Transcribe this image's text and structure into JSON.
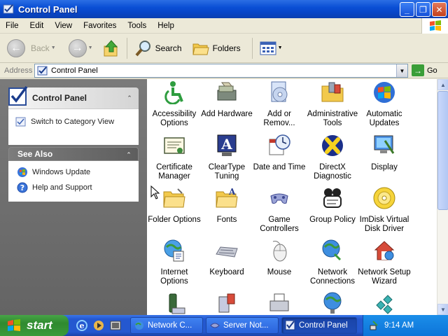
{
  "window": {
    "title": "Control Panel"
  },
  "menu": [
    "File",
    "Edit",
    "View",
    "Favorites",
    "Tools",
    "Help"
  ],
  "toolbar": {
    "back": "Back",
    "search": "Search",
    "folders": "Folders"
  },
  "address": {
    "label": "Address",
    "value": "Control Panel",
    "go": "Go"
  },
  "left": {
    "panel_title": "Control Panel",
    "switch_view": "Switch to Category View",
    "see_also_title": "See Also",
    "see_also": [
      "Windows Update",
      "Help and Support"
    ]
  },
  "items": [
    {
      "label": "Accessibility Options"
    },
    {
      "label": "Add Hardware"
    },
    {
      "label": "Add or Remov..."
    },
    {
      "label": "Administrative Tools"
    },
    {
      "label": "Automatic Updates"
    },
    {
      "label": "Certificate Manager"
    },
    {
      "label": "ClearType Tuning"
    },
    {
      "label": "Date and Time"
    },
    {
      "label": "DirectX Diagnostic"
    },
    {
      "label": "Display"
    },
    {
      "label": "Folder Options"
    },
    {
      "label": "Fonts"
    },
    {
      "label": "Game Controllers"
    },
    {
      "label": "Group Policy"
    },
    {
      "label": "ImDisk Virtual Disk Driver"
    },
    {
      "label": "Internet Options"
    },
    {
      "label": "Keyboard"
    },
    {
      "label": "Mouse"
    },
    {
      "label": "Network Connections"
    },
    {
      "label": "Network Setup Wizard"
    }
  ],
  "taskbar": {
    "start": "start",
    "tasks": [
      "Network C...",
      "Server Not...",
      "Control Panel"
    ],
    "clock": "9:14 AM"
  },
  "colors": {
    "title_blue": "#0a4fd5",
    "start_green": "#3a9b3a",
    "tray_blue": "#0d74d9"
  }
}
